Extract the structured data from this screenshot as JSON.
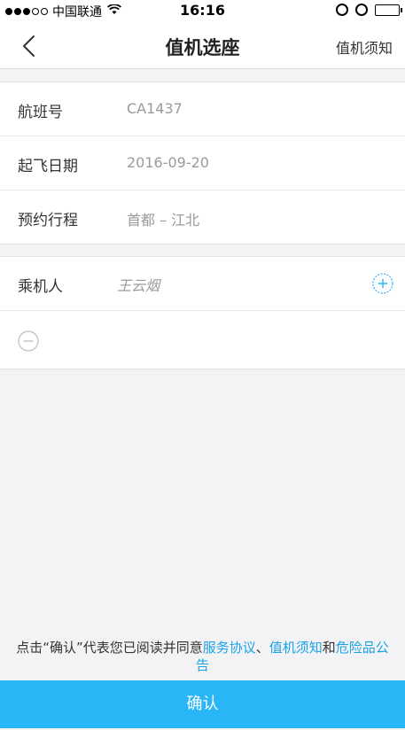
{
  "status_bar": {
    "carrier": "中国联通",
    "time": "16:16"
  },
  "nav": {
    "title": "值机选座",
    "right_label": "值机须知"
  },
  "flight_info": [
    {
      "label": "航班号",
      "value": "CA1437"
    },
    {
      "label": "起飞日期",
      "value": "2016-09-20"
    },
    {
      "label": "预约行程",
      "value": "首都 – 江北"
    }
  ],
  "passenger": {
    "label": "乘机人",
    "value": "王云烟"
  },
  "agreement": {
    "prefix": "点击“确认”代表您已阅读并同意",
    "link1": "服务协议",
    "sep": "、",
    "link2": "值机须知",
    "and": "和",
    "link3": "危险品公告"
  },
  "confirm_label": "确认",
  "colors": {
    "accent": "#29b6f6",
    "link": "#1aa3e8"
  }
}
